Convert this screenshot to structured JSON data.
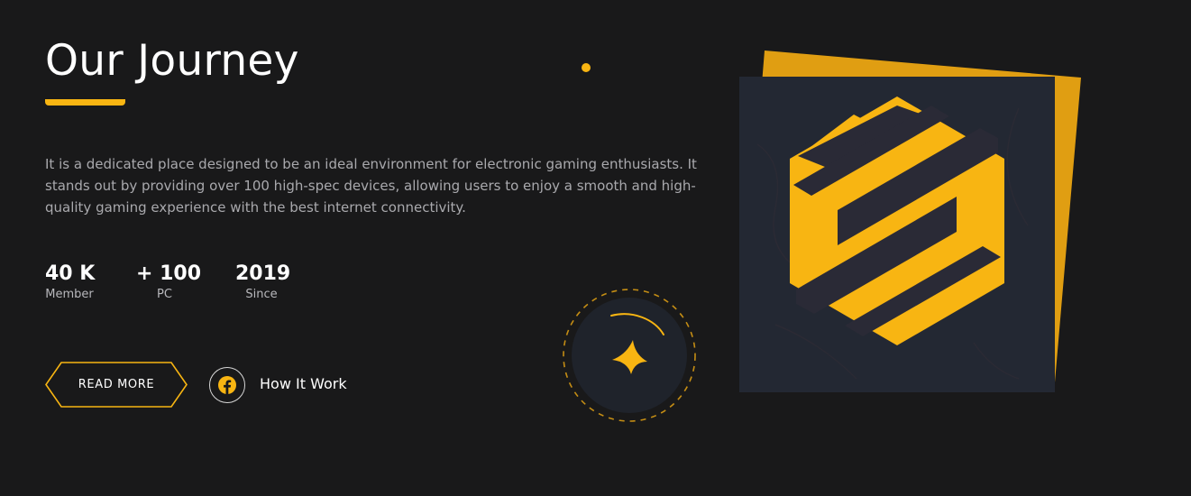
{
  "about": {
    "title": "Our Journey",
    "description": "It is a dedicated place designed to be an ideal environment for electronic gaming enthusiasts. It stands out by providing over 100 high-spec devices, allowing users to enjoy a smooth and high-quality gaming experience with the best internet connectivity."
  },
  "stats": [
    {
      "value": "40 K",
      "label": "Member"
    },
    {
      "value": "+ 100",
      "label": "PC"
    },
    {
      "value": "2019",
      "label": "Since"
    }
  ],
  "actions": {
    "read_more_label": "READ MORE",
    "how_it_work_label": "How It Work"
  },
  "icons": {
    "facebook": "facebook-icon",
    "spark": "four-point-star-icon",
    "logo": "hexagon-s-logo"
  },
  "colors": {
    "background": "#19191a",
    "accent": "#f8b512",
    "panel": "#232833",
    "text_muted": "#a9a9ad"
  }
}
